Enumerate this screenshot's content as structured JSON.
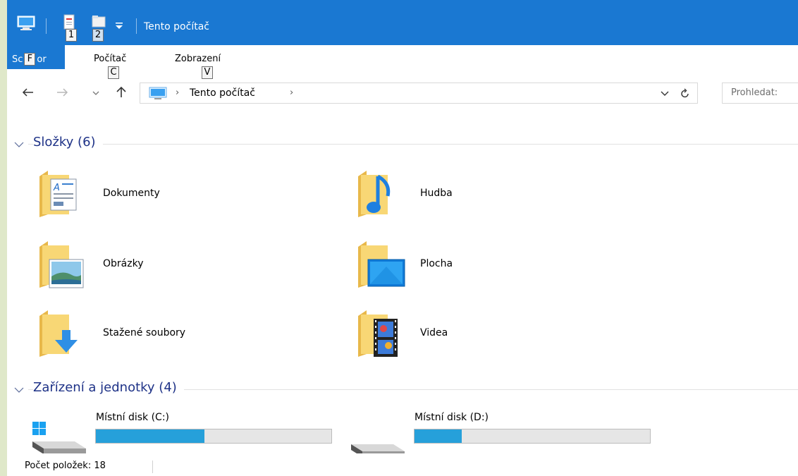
{
  "titlebar": {
    "title": "Tento počítač",
    "keytip_1": "1",
    "keytip_2": "2"
  },
  "ribbon": {
    "file_tab": "Soubor",
    "file_tab_left": "Sc",
    "file_tab_right": "or",
    "file_keytip": "F",
    "computer_tab": "Počítač",
    "computer_keytip": "C",
    "view_tab": "Zobrazení",
    "view_keytip": "V"
  },
  "address": {
    "location": "Tento počítač",
    "search_placeholder": "Prohledat:"
  },
  "groups": [
    {
      "title": "Složky (6)"
    },
    {
      "title": "Zařízení a jednotky (4)"
    }
  ],
  "folders": [
    {
      "label": "Dokumenty",
      "icon": "documents-folder-icon"
    },
    {
      "label": "Hudba",
      "icon": "music-folder-icon"
    },
    {
      "label": "Obrázky",
      "icon": "pictures-folder-icon"
    },
    {
      "label": "Plocha",
      "icon": "desktop-folder-icon"
    },
    {
      "label": "Stažené soubory",
      "icon": "downloads-folder-icon"
    },
    {
      "label": "Videa",
      "icon": "videos-folder-icon"
    }
  ],
  "drives": [
    {
      "label": "Místní disk (C:)",
      "used_fraction": 0.46
    },
    {
      "label": "Místní disk (D:)",
      "used_fraction": 0.2
    }
  ],
  "status": {
    "count": "Počet položek: 18"
  },
  "colors": {
    "accent": "#1a78d2",
    "header_text": "#1e3287",
    "drive_fill": "#26a0da"
  }
}
